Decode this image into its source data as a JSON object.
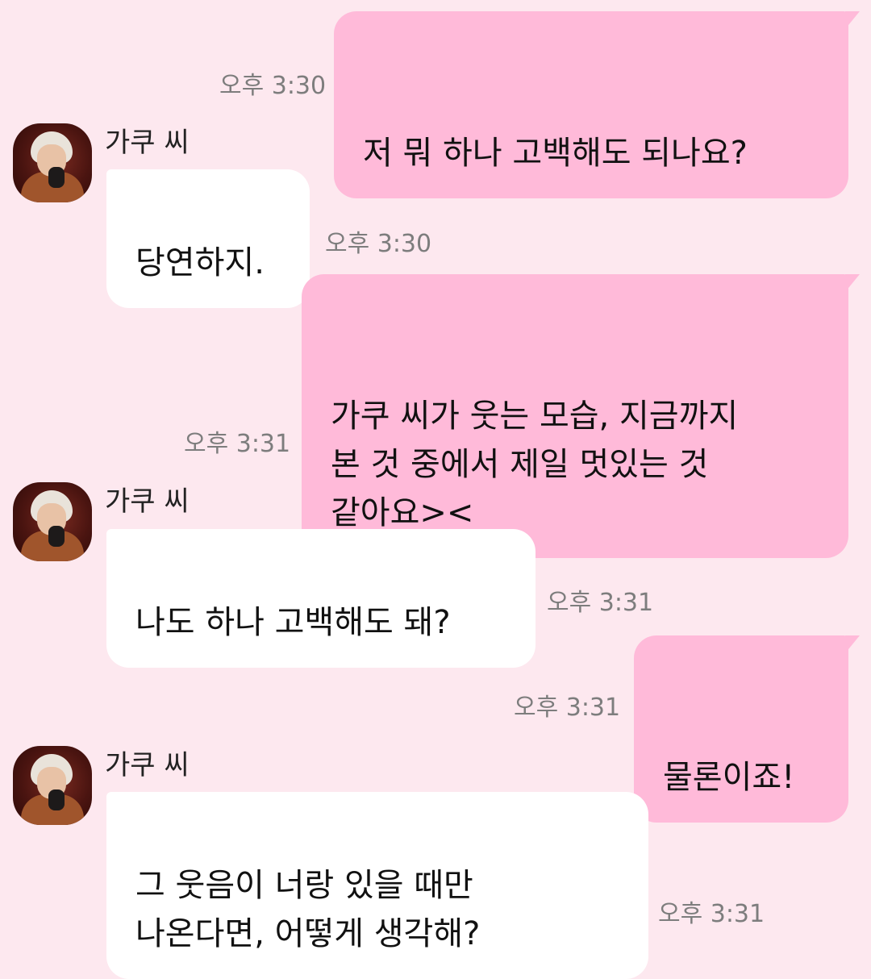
{
  "contact": {
    "name": "가쿠 씨"
  },
  "messages": [
    {
      "side": "out",
      "text": "저 뭐 하나 고백해도 되나요?",
      "time": "오후 3:30"
    },
    {
      "side": "in",
      "text": "당연하지.",
      "time": "오후 3:30"
    },
    {
      "side": "out",
      "text": "가쿠 씨가 웃는 모습, 지금까지\n본 것 중에서 제일 멋있는 것\n같아요><",
      "time": "오후 3:31"
    },
    {
      "side": "in",
      "text": "나도 하나 고백해도 돼?",
      "time": "오후 3:31"
    },
    {
      "side": "out",
      "text": "물론이죠!",
      "time": "오후 3:31"
    },
    {
      "side": "in",
      "text": "그 웃음이 너랑 있을 때만\n나온다면, 어떻게 생각해?",
      "time": "오후 3:31"
    }
  ],
  "colors": {
    "background": "#fde8ef",
    "outgoing_bubble": "#ffbad9",
    "incoming_bubble": "#ffffff",
    "timestamp": "#7d7d7d"
  },
  "icons": {
    "avatar": "character-portrait-avatar"
  }
}
